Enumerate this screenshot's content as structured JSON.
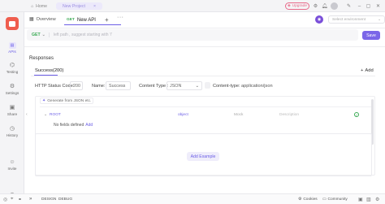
{
  "titlebar": {
    "home_label": "Home",
    "project_tab_label": "New Project",
    "upgrade_label": "Upgrade"
  },
  "sidebar": {
    "items": [
      {
        "label": "APIs",
        "icon": "api-icon",
        "active": true
      },
      {
        "label": "Testing",
        "icon": "testing-icon",
        "active": false
      },
      {
        "label": "Settings",
        "icon": "settings-icon",
        "active": false
      },
      {
        "label": "Share",
        "icon": "share-icon",
        "active": false
      },
      {
        "label": "History",
        "icon": "history-icon",
        "active": false
      },
      {
        "label": "Invite",
        "icon": "invite-icon",
        "active": false
      }
    ]
  },
  "header": {
    "overview_label": "Overview",
    "api_tab_method": "GET",
    "api_tab_name": "New API",
    "environment_placeholder": "Select environment"
  },
  "request": {
    "method": "GET",
    "url_placeholder": "left path , suggest starting with '/'",
    "save_label": "Save"
  },
  "responses": {
    "section_label": "Responses",
    "tabs": [
      {
        "label": "Success(200)"
      }
    ],
    "add_label": "Add",
    "fields": {
      "status_code_label": "HTTP Status Code:",
      "status_code_value": "200",
      "name_label": "Name:",
      "name_value": "Success",
      "content_type_label": "Content Type :",
      "content_type_value": "JSON",
      "content_type2_label": "Content-type:",
      "content_type2_value": "application/json"
    },
    "schema": {
      "generate_label": "Generate from JSON etc.",
      "root_name": "ROOT",
      "root_type": "object",
      "mock_placeholder": "Mock",
      "description_placeholder": "Description",
      "no_fields_text": "No fields defined",
      "add_link": "Add"
    },
    "add_example_label": "Add Example"
  },
  "bottombar": {
    "design_label": "DESIGN",
    "debug_label": "DEBUG",
    "cookies_label": "Cookies",
    "community_label": "Community"
  },
  "colors": {
    "accent": "#6b5ee6",
    "get_method": "#3aaa54",
    "logo": "#ef5d4e",
    "upgrade": "#e86a8a"
  }
}
